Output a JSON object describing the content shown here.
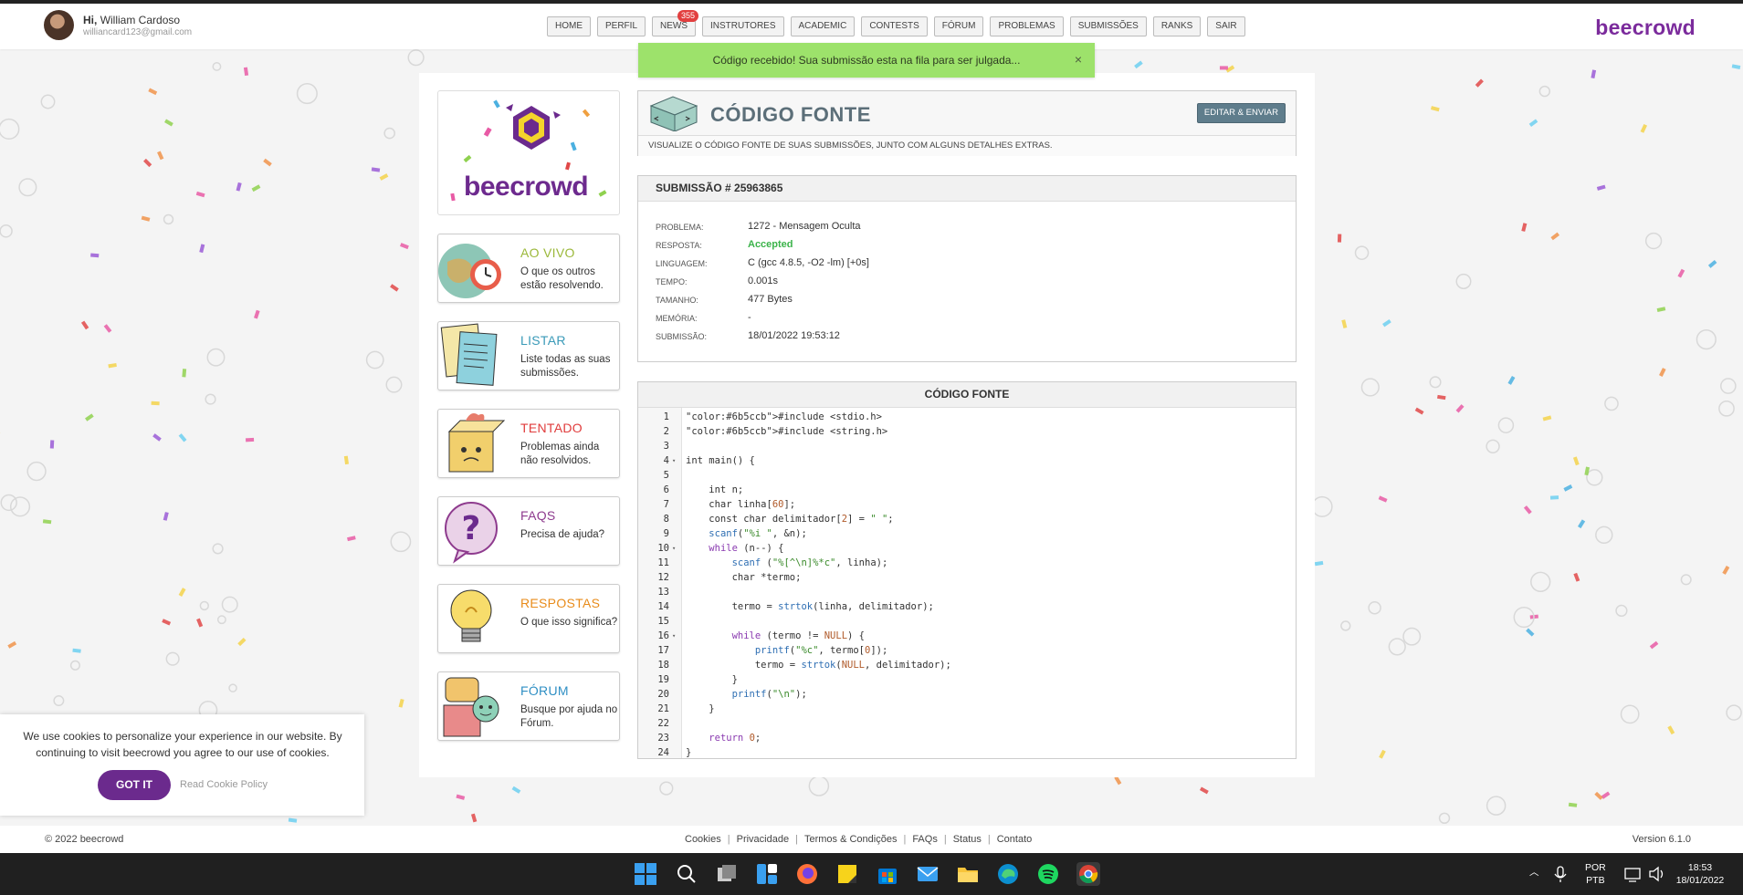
{
  "header": {
    "greeting": "Hi,",
    "user_name": "William Cardoso",
    "user_email": "williancard123@gmail.com",
    "brand": "beecrowd"
  },
  "nav": {
    "items": [
      "HOME",
      "PERFIL",
      "NEWS",
      "INSTRUTORES",
      "ACADEMIC",
      "CONTESTS",
      "FÓRUM",
      "PROBLEMAS",
      "SUBMISSÕES",
      "RANKS",
      "SAIR"
    ],
    "news_badge": "355"
  },
  "toast": {
    "message": "Código recebido! Sua submissão esta na fila para ser julgada...",
    "close": "×"
  },
  "sidebar": {
    "logo_text": "beecrowd",
    "cards": [
      {
        "title": "AO VIVO",
        "desc": "O que os outros estão resolvendo.",
        "color": "#9bb83a"
      },
      {
        "title": "LISTAR",
        "desc": "Liste todas as suas submissões.",
        "color": "#3a9ab8"
      },
      {
        "title": "TENTADO",
        "desc": "Problemas ainda não resolvidos.",
        "color": "#e03b3b"
      },
      {
        "title": "FAQS",
        "desc": "Precisa de ajuda?",
        "color": "#8e3b8e"
      },
      {
        "title": "RESPOSTAS",
        "desc": "O que isso significa?",
        "color": "#e88b1a"
      },
      {
        "title": "FÓRUM",
        "desc": "Busque por ajuda no Fórum.",
        "color": "#2f8fc4"
      }
    ]
  },
  "source_header": {
    "title": "CÓDIGO FONTE",
    "edit_button": "EDITAR & ENVIAR",
    "subtitle": "VISUALIZE O CÓDIGO FONTE DE SUAS SUBMISSÕES, JUNTO COM ALGUNS DETALHES EXTRAS."
  },
  "submission": {
    "heading": "SUBMISSÃO # 25963865",
    "rows": [
      {
        "label": "PROBLEMA:",
        "value": "1272 - Mensagem Oculta"
      },
      {
        "label": "RESPOSTA:",
        "value": "Accepted"
      },
      {
        "label": "LINGUAGEM:",
        "value": "C (gcc 4.8.5, -O2 -lm) [+0s]"
      },
      {
        "label": "TEMPO:",
        "value": "0.001s"
      },
      {
        "label": "TAMANHO:",
        "value": "477 Bytes"
      },
      {
        "label": "MEMÓRIA:",
        "value": "-"
      },
      {
        "label": "SUBMISSÃO:",
        "value": "18/01/2022 19:53:12"
      }
    ]
  },
  "code": {
    "heading": "CÓDIGO FONTE",
    "lines": [
      {
        "n": "1",
        "text": "#include <stdio.h>",
        "fold": ""
      },
      {
        "n": "2",
        "text": "#include <string.h>",
        "fold": ""
      },
      {
        "n": "3",
        "text": "",
        "fold": ""
      },
      {
        "n": "4",
        "text": "int main() {",
        "fold": "▾"
      },
      {
        "n": "5",
        "text": "",
        "fold": ""
      },
      {
        "n": "6",
        "text": "    int n;",
        "fold": ""
      },
      {
        "n": "7",
        "text": "    char linha[60];",
        "fold": ""
      },
      {
        "n": "8",
        "text": "    const char delimitador[2] = \" \";",
        "fold": ""
      },
      {
        "n": "9",
        "text": "    scanf(\"%i \", &n);",
        "fold": ""
      },
      {
        "n": "10",
        "text": "    while (n--) {",
        "fold": "▾"
      },
      {
        "n": "11",
        "text": "        scanf (\"%[^\\n]%*c\", linha);",
        "fold": ""
      },
      {
        "n": "12",
        "text": "        char *termo;",
        "fold": ""
      },
      {
        "n": "13",
        "text": "",
        "fold": ""
      },
      {
        "n": "14",
        "text": "        termo = strtok(linha, delimitador);",
        "fold": ""
      },
      {
        "n": "15",
        "text": "",
        "fold": ""
      },
      {
        "n": "16",
        "text": "        while (termo != NULL) {",
        "fold": "▾"
      },
      {
        "n": "17",
        "text": "            printf(\"%c\", termo[0]);",
        "fold": ""
      },
      {
        "n": "18",
        "text": "            termo = strtok(NULL, delimitador);",
        "fold": ""
      },
      {
        "n": "19",
        "text": "        }",
        "fold": ""
      },
      {
        "n": "20",
        "text": "        printf(\"\\n\");",
        "fold": ""
      },
      {
        "n": "21",
        "text": "    }",
        "fold": ""
      },
      {
        "n": "22",
        "text": "",
        "fold": ""
      },
      {
        "n": "23",
        "text": "    return 0;",
        "fold": ""
      },
      {
        "n": "24",
        "text": "}",
        "fold": ""
      }
    ]
  },
  "cookie": {
    "text": "We use cookies to personalize your experience in our website. By continuing to visit beecrowd you agree to our use of cookies.",
    "button": "GOT IT",
    "link": "Read Cookie Policy"
  },
  "footer": {
    "copyright": "© 2022 beecrowd",
    "links": [
      "Cookies",
      "Privacidade",
      "Termos & Condições",
      "FAQs",
      "Status",
      "Contato"
    ],
    "version": "Version 6.1.0"
  },
  "taskbar": {
    "lang_line1": "POR",
    "lang_line2": "PTB",
    "time": "18:53",
    "date": "18/01/2022"
  }
}
